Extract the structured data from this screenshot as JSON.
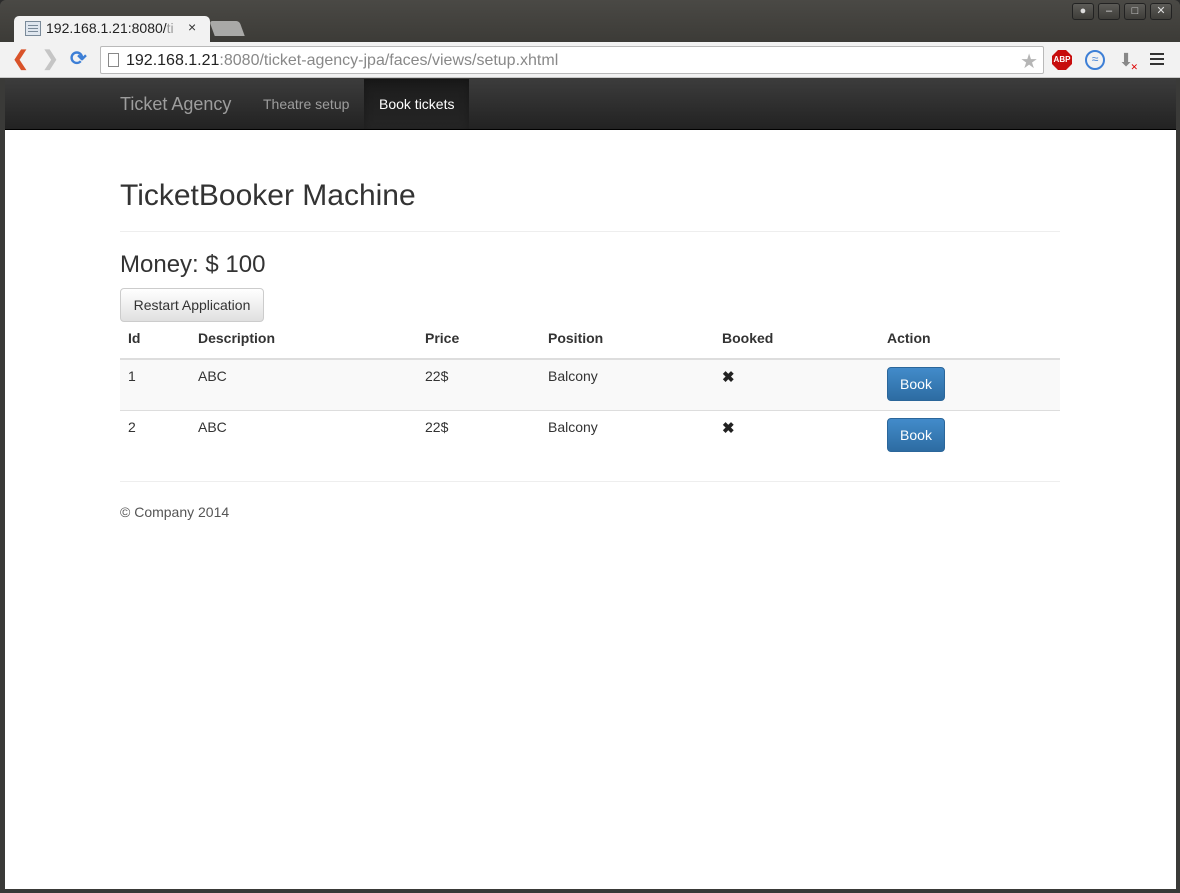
{
  "browser": {
    "tab_title_main": "192.168.1.21:8080/",
    "tab_title_fade": "ti",
    "tab_close": "×",
    "url_host": "192.168.1.21",
    "url_rest": ":8080/ticket-agency-jpa/faces/views/setup.xhtml",
    "window_buttons": [
      "●",
      "–",
      "□",
      "✕"
    ],
    "ext_abp": "ABP"
  },
  "navbar": {
    "brand": "Ticket Agency",
    "links": [
      "Theatre setup",
      "Book tickets"
    ],
    "active": "Book tickets"
  },
  "main": {
    "title": "TicketBooker Machine",
    "money": "Money: $ 100",
    "restart_label": "Restart Application",
    "table": {
      "headers": [
        "Id",
        "Description",
        "Price",
        "Position",
        "Booked",
        "Action"
      ],
      "rows": [
        {
          "id": "1",
          "description": "ABC",
          "price": "22$",
          "position": "Balcony",
          "booked": "✖",
          "action": "Book"
        },
        {
          "id": "2",
          "description": "ABC",
          "price": "22$",
          "position": "Balcony",
          "booked": "✖",
          "action": "Book"
        }
      ]
    }
  },
  "footer": {
    "text": "© Company 2014"
  },
  "colors": {
    "primary_button": "#428bca",
    "navbar": "#222222",
    "back_arrow": "#d9532a"
  }
}
